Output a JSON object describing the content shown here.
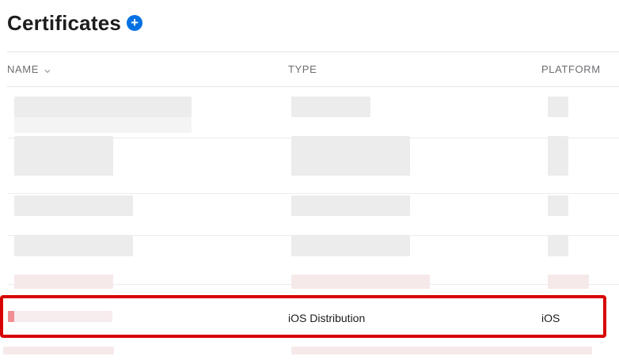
{
  "page": {
    "title": "Certificates",
    "add_icon": "plus-circle-icon",
    "accent_color": "#0071e3",
    "highlight_color": "#d70000"
  },
  "table": {
    "columns": [
      "NAME",
      "TYPE",
      "PLATFORM"
    ],
    "sort_icon": "chevron-down-icon",
    "highlighted_row": {
      "type": "iOS Distribution",
      "platform": "iOS"
    }
  }
}
